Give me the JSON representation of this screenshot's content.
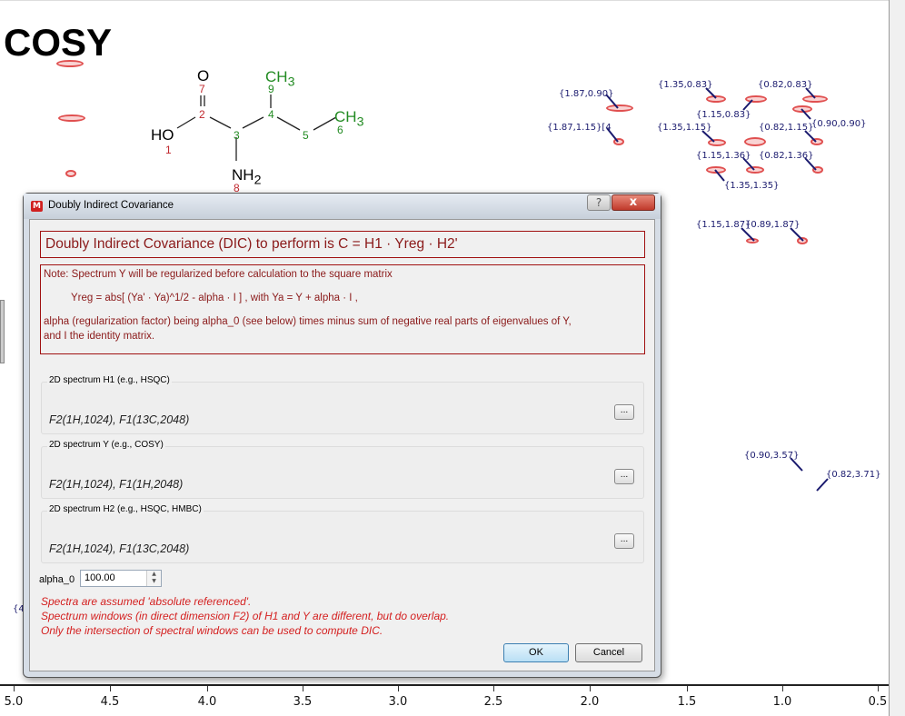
{
  "plot": {
    "title": "COSY",
    "x_axis_ticks": [
      "5.0",
      "4.5",
      "4.0",
      "3.5",
      "3.0",
      "2.5",
      "2.0",
      "1.5",
      "1.0",
      "0.5"
    ],
    "peak_labels": [
      "{1.87,0.90}",
      "{1.87,1.15}[4",
      "{1.35,0.83}",
      "{1.15,0.83}",
      "{0.82,0.83}",
      "{0.90,0.90}",
      "{1.35,1.15}",
      "{0.82,1.15}",
      "{1.15,1.36}",
      "{0.82,1.36}",
      "{1.35,1.35}",
      "{1.15,1.87}",
      "{0.89,1.87}",
      "{0.90,3.57}",
      "{0.82,3.71}",
      "{4"
    ],
    "peak_color": "#e05050",
    "label_color": "#1a1a6e"
  },
  "molecule": {
    "atoms": {
      "O": "O",
      "HO": "HO",
      "NH2": "NH",
      "NH2_sub": "2",
      "CH3a": "CH",
      "CH3a_sub": "3",
      "CH3b": "CH",
      "CH3b_sub": "3"
    },
    "numbers": [
      "1",
      "2",
      "3",
      "4",
      "5",
      "6",
      "7",
      "8",
      "9"
    ]
  },
  "dialog": {
    "title": "Doubly Indirect Covariance",
    "help_label": "?",
    "close_label": "x",
    "heading": "Doubly Indirect Covariance (DIC) to perform is C = H1 · Yreg · H2'",
    "note_line1": "Note: Spectrum Y will be regularized before calculation to the square matrix",
    "note_line2": "Yreg = abs[ (Ya' · Ya)^1/2 - alpha · I ] ,   with Ya = Y + alpha · I ,",
    "note_line3": "alpha (regularization factor) being alpha_0 (see below) times minus sum of negative real parts of eigenvalues of Y,",
    "note_line4": "and I the identity matrix.",
    "groups": [
      {
        "label": "2D spectrum H1 (e.g., HSQC)",
        "value": "F2(1H,1024), F1(13C,2048)",
        "button": "..."
      },
      {
        "label": "2D spectrum Y (e.g., COSY)",
        "value": "F2(1H,1024), F1(1H,2048)",
        "button": "..."
      },
      {
        "label": "2D spectrum H2 (e.g., HSQC, HMBC)",
        "value": "F2(1H,1024), F1(13C,2048)",
        "button": "..."
      }
    ],
    "alpha_label": "alpha_0",
    "alpha_value": "100.00",
    "warnings": [
      "Spectra are assumed 'absolute referenced'.",
      "Spectrum windows (in direct dimension F2) of H1 and Y are different, but do overlap.",
      "Only the intersection of spectral windows can be used to compute DIC."
    ],
    "ok_label": "OK",
    "cancel_label": "Cancel"
  }
}
